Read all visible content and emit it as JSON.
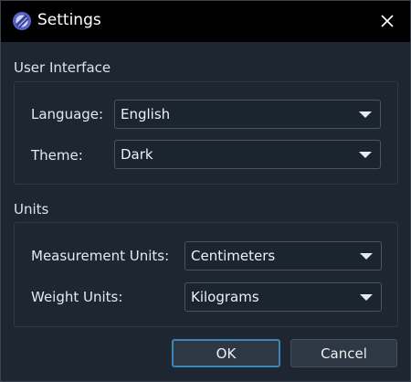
{
  "window": {
    "title": "Settings",
    "close_icon": "close-icon",
    "app_icon": "settings-app-icon"
  },
  "user_interface": {
    "heading": "User Interface",
    "language": {
      "label": "Language:",
      "value": "English"
    },
    "theme": {
      "label": "Theme:",
      "value": "Dark"
    }
  },
  "units": {
    "heading": "Units",
    "measurement": {
      "label": "Measurement Units:",
      "value": "Centimeters"
    },
    "weight": {
      "label": "Weight Units:",
      "value": "Kilograms"
    }
  },
  "buttons": {
    "ok": "OK",
    "cancel": "Cancel"
  },
  "colors": {
    "background": "#1e2731",
    "titlebar": "#000000",
    "accent": "#3b86b8"
  }
}
